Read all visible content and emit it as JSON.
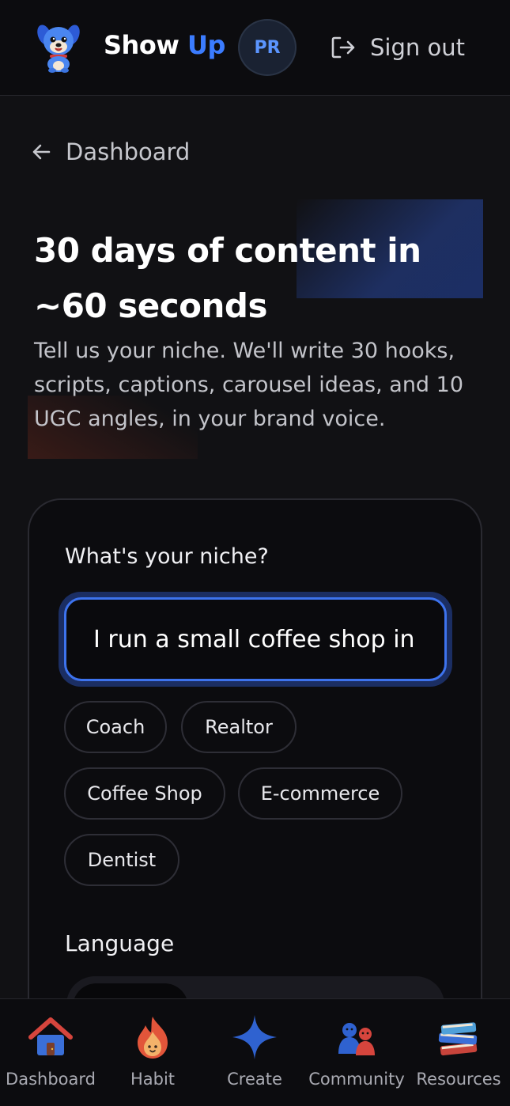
{
  "header": {
    "brand_part1": "Show",
    "brand_part2": "Up",
    "avatar_initials": "PR",
    "sign_out_label": "Sign out",
    "logo_icon": "dog-mascot-icon",
    "sign_out_icon": "sign-out-icon"
  },
  "back_link": {
    "label": "Dashboard",
    "icon": "arrow-left-icon"
  },
  "hero": {
    "title_line1": "30 days of content in",
    "title_line2": "~60 seconds",
    "subtitle": "Tell us your niche. We'll write 30 hooks, scripts, captions, carousel ideas, and 10 UGC angles, in your brand voice."
  },
  "form": {
    "niche_label": "What's your niche?",
    "niche_value": "I run a small coffee shop in",
    "chips": [
      "Coach",
      "Realtor",
      "Coffee Shop",
      "E-commerce",
      "Dentist"
    ],
    "language_label": "Language"
  },
  "bottom_nav": {
    "items": [
      {
        "label": "Dashboard",
        "icon": "house-icon"
      },
      {
        "label": "Habit",
        "icon": "flame-icon"
      },
      {
        "label": "Create",
        "icon": "sparkle-icon"
      },
      {
        "label": "Community",
        "icon": "people-icon"
      },
      {
        "label": "Resources",
        "icon": "books-icon"
      }
    ]
  },
  "colors": {
    "accent": "#3b7cff",
    "background": "#111114",
    "surface": "#0c0c0f"
  }
}
